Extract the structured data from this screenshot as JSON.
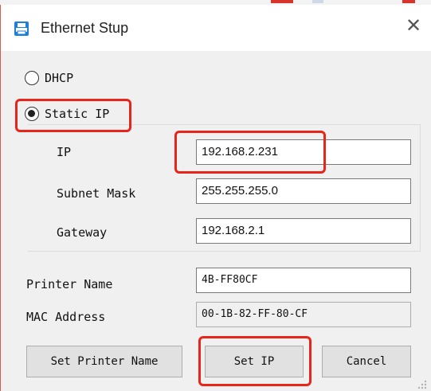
{
  "window": {
    "title": "Ethernet Stup",
    "icon": "printer-icon",
    "close_glyph": "✕"
  },
  "mode": {
    "dhcp_label": "DHCP",
    "static_label": "Static IP",
    "selected": "Static IP"
  },
  "static": {
    "ip_label": "IP",
    "ip_value": "192.168.2.231",
    "subnet_label": "Subnet Mask",
    "subnet_value": "255.255.255.0",
    "gateway_label": "Gateway",
    "gateway_value": "192.168.2.1"
  },
  "printer": {
    "name_label": "Printer Name",
    "name_value": "4B-FF80CF",
    "mac_label": "MAC Address",
    "mac_value": "00-1B-82-FF-80-CF"
  },
  "buttons": {
    "set_printer_name": "Set Printer Name",
    "set_ip": "Set IP",
    "cancel": "Cancel"
  },
  "colors": {
    "highlight": "#e8251b",
    "icon_blue": "#1e7fd6"
  }
}
